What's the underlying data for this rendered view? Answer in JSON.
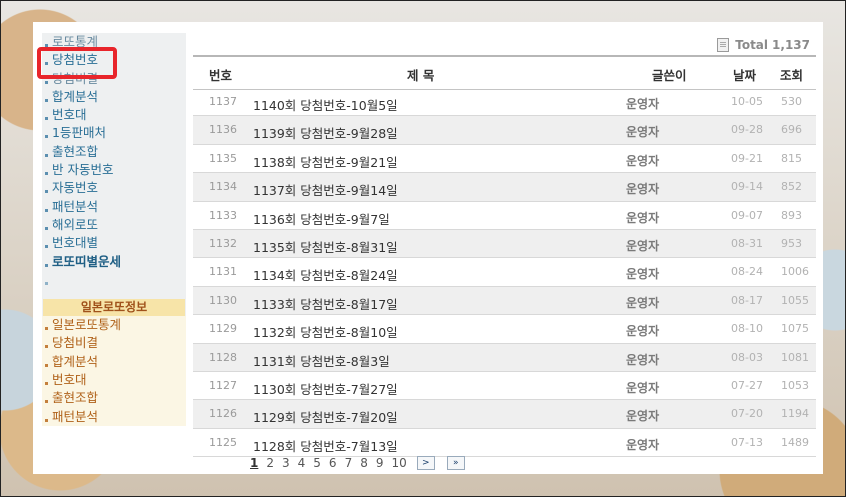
{
  "sidebar": {
    "items": [
      {
        "label": "로또통계"
      },
      {
        "label": "당첨번호"
      },
      {
        "label": "당첨비결"
      },
      {
        "label": "합계분석"
      },
      {
        "label": "번호대"
      },
      {
        "label": "1등판매처"
      },
      {
        "label": "출현조합"
      },
      {
        "label": "반 자동번호"
      },
      {
        "label": "자동번호"
      },
      {
        "label": "패턴분석"
      },
      {
        "label": "해외로또"
      },
      {
        "label": "번호대별"
      },
      {
        "label": "로또띠별운세"
      },
      {
        "label": ""
      }
    ],
    "japan_title": "일본로또정보",
    "japan_items": [
      {
        "label": "일본로또통계"
      },
      {
        "label": "당첨비결"
      },
      {
        "label": "합계분석"
      },
      {
        "label": "번호대"
      },
      {
        "label": "출현조합"
      },
      {
        "label": "패턴분석"
      }
    ]
  },
  "board": {
    "total_label": "Total",
    "total_count": "1,137",
    "headers": {
      "num": "번호",
      "title": "제 목",
      "writer": "글쓴이",
      "date": "날짜",
      "views": "조회"
    },
    "rows": [
      {
        "num": "1137",
        "title": "1140회 당첨번호-10월5일",
        "writer": "운영자",
        "date": "10-05",
        "views": "530"
      },
      {
        "num": "1136",
        "title": "1139회 당첨번호-9월28일",
        "writer": "운영자",
        "date": "09-28",
        "views": "696"
      },
      {
        "num": "1135",
        "title": "1138회 당첨번호-9월21일",
        "writer": "운영자",
        "date": "09-21",
        "views": "815"
      },
      {
        "num": "1134",
        "title": "1137회 당첨번호-9월14일",
        "writer": "운영자",
        "date": "09-14",
        "views": "852"
      },
      {
        "num": "1133",
        "title": "1136회 당첨번호-9월7일",
        "writer": "운영자",
        "date": "09-07",
        "views": "893"
      },
      {
        "num": "1132",
        "title": "1135회 당첨번호-8월31일",
        "writer": "운영자",
        "date": "08-31",
        "views": "953"
      },
      {
        "num": "1131",
        "title": "1134회 당첨번호-8월24일",
        "writer": "운영자",
        "date": "08-24",
        "views": "1006"
      },
      {
        "num": "1130",
        "title": "1133회 당첨번호-8월17일",
        "writer": "운영자",
        "date": "08-17",
        "views": "1055"
      },
      {
        "num": "1129",
        "title": "1132회 당첨번호-8월10일",
        "writer": "운영자",
        "date": "08-10",
        "views": "1075"
      },
      {
        "num": "1128",
        "title": "1131회 당첨번호-8월3일",
        "writer": "운영자",
        "date": "08-03",
        "views": "1081"
      },
      {
        "num": "1127",
        "title": "1130회 당첨번호-7월27일",
        "writer": "운영자",
        "date": "07-27",
        "views": "1053"
      },
      {
        "num": "1126",
        "title": "1129회 당첨번호-7월20일",
        "writer": "운영자",
        "date": "07-20",
        "views": "1194"
      },
      {
        "num": "1125",
        "title": "1128회 당첨번호-7월13일",
        "writer": "운영자",
        "date": "07-13",
        "views": "1489"
      }
    ]
  },
  "pager": {
    "pages": [
      "1",
      "2",
      "3",
      "4",
      "5",
      "6",
      "7",
      "8",
      "9",
      "10"
    ],
    "current": "1",
    "next_label": ">",
    "last_label": "»"
  },
  "colors": {
    "highlight": "#e8252b",
    "menu_text": "#2a6f96",
    "japan_header_bg": "#f7e4a8"
  }
}
